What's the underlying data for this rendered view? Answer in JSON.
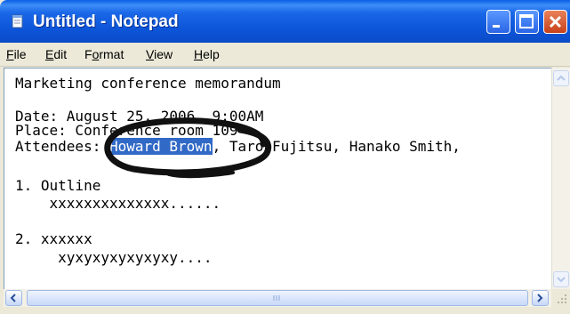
{
  "window": {
    "title": "Untitled - Notepad",
    "colors": {
      "titlebar": "#0c54d8",
      "selection": "#3169c6",
      "annotation": "#111111"
    }
  },
  "menu": [
    {
      "label": "File",
      "mnemonic": "F",
      "rest": "ile"
    },
    {
      "label": "Edit",
      "mnemonic": "E",
      "rest": "dit"
    },
    {
      "label": "Format",
      "mnemonic": "o",
      "pre": "F",
      "rest": "rmat"
    },
    {
      "label": "View",
      "mnemonic": "V",
      "rest": "iew"
    },
    {
      "label": "Help",
      "mnemonic": "H",
      "rest": "elp"
    }
  ],
  "document": {
    "line1": "Marketing conference memorandum",
    "line3": "Date: August 25, 2006, 9:00AM",
    "line4": "Place: Conference room 109",
    "line5_before": "Attendees: ",
    "line5_selected": "Howard Brown",
    "line5_after": ", Taro Fujitsu, Hanako Smith,",
    "line7": "1. Outline",
    "line8": "    xxxxxxxxxxxxxx......",
    "line10": "2. xxxxxx",
    "line11": "     xyxyxyxyxyxyxy...."
  },
  "icons": [
    "notepad-icon",
    "minimize-icon",
    "maximize-icon",
    "close-icon",
    "scroll-up-icon",
    "scroll-down-icon",
    "scroll-left-icon",
    "scroll-right-icon",
    "resize-grip-icon"
  ]
}
